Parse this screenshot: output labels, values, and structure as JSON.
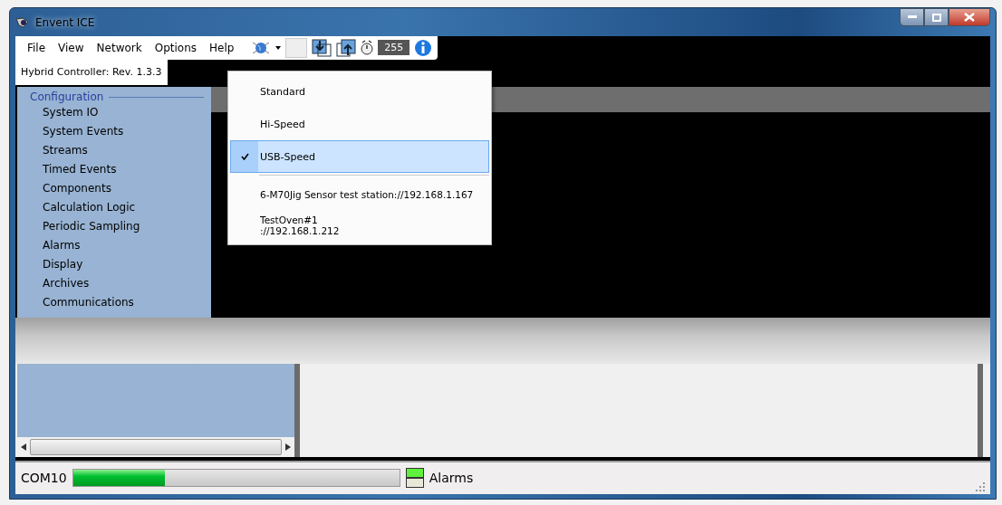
{
  "window": {
    "title": "Envent ICE"
  },
  "menu": [
    "File",
    "View",
    "Network",
    "Options",
    "Help"
  ],
  "toolbar": {
    "counter": "255"
  },
  "controller_label": "Hybrid Controller: Rev. 1.3.3",
  "sidebar": {
    "group": "Configuration",
    "items": [
      "System IO",
      "System Events",
      "Streams",
      "Timed Events",
      "Components",
      "Calculation Logic",
      "Periodic Sampling",
      "Alarms",
      "Display",
      "Archives",
      "Communications"
    ]
  },
  "dropdown": [
    {
      "label": "Standard",
      "kind": "option",
      "checked": false,
      "highlighted": false
    },
    {
      "label": "Hi-Speed",
      "kind": "option",
      "checked": false,
      "highlighted": false
    },
    {
      "label": "USB-Speed",
      "kind": "option",
      "checked": true,
      "highlighted": true
    },
    {
      "label": "6-M70Jig Sensor test station://192.168.1.167",
      "kind": "connection",
      "checked": false,
      "highlighted": false
    },
    {
      "label": "TestOven#1\n://192.168.1.212",
      "kind": "connection",
      "checked": false,
      "highlighted": false
    }
  ],
  "status_bar": {
    "port": "COM10",
    "progress": {
      "level": 0.28
    },
    "alarm_label": "Alarms"
  }
}
